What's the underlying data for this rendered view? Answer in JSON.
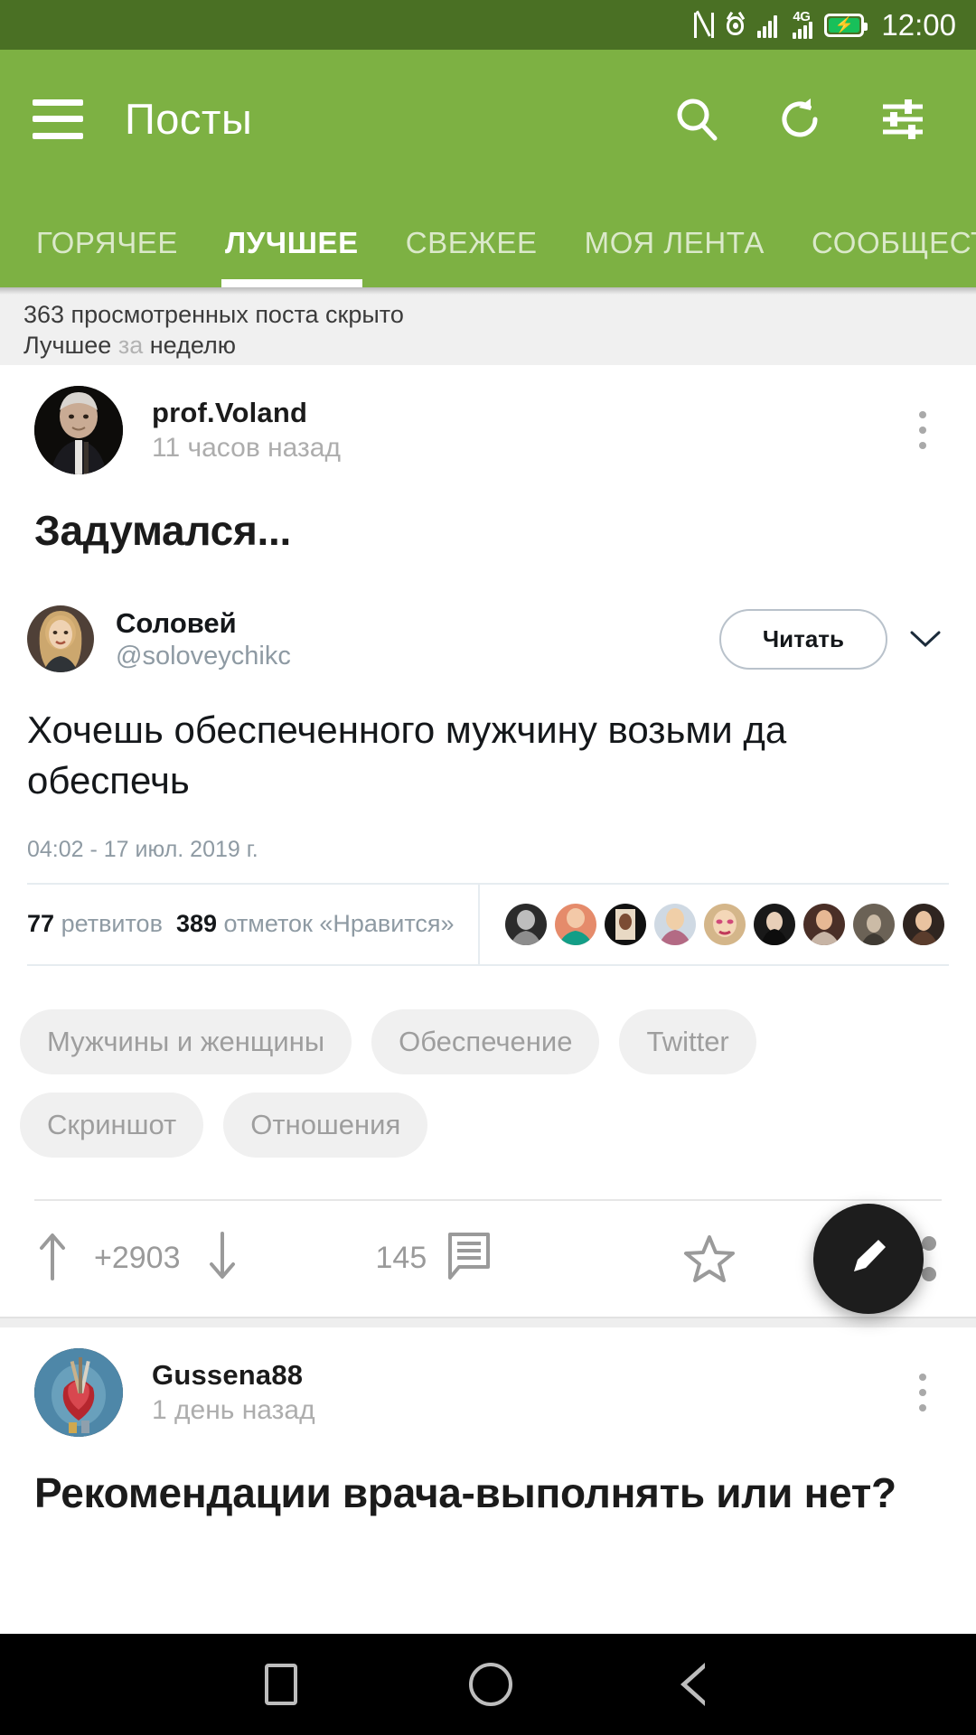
{
  "status_bar": {
    "time": "12:00",
    "icons": [
      "nfc-icon",
      "eye-icon",
      "signal-icon",
      "signal-4g-icon",
      "battery-charging-icon"
    ],
    "network_label": "4G"
  },
  "app_bar": {
    "title": "Посты",
    "menu_icon": "hamburger-icon",
    "actions": [
      "search-icon",
      "refresh-icon",
      "filter-icon"
    ]
  },
  "tabs": [
    {
      "label": "ГОРЯЧЕЕ",
      "active": false
    },
    {
      "label": "ЛУЧШЕЕ",
      "active": true
    },
    {
      "label": "СВЕЖЕЕ",
      "active": false
    },
    {
      "label": "МОЯ ЛЕНТА",
      "active": false
    },
    {
      "label": "СООБЩЕСТВА",
      "active": false
    }
  ],
  "info_strip": {
    "hidden_posts": "363 просмотренных поста скрыто",
    "sort_prefix": "Лучшее",
    "sort_dim": "за",
    "sort_suffix": "неделю"
  },
  "posts": [
    {
      "author": "prof.Voland",
      "time": "11 часов назад",
      "title": "Задумался...",
      "embed": {
        "name": "Соловей",
        "handle": "@soloveychikc",
        "read_button": "Читать",
        "text": "Хочешь  обеспеченного мужчину возьми да обеспечь",
        "date": "04:02 - 17 июл. 2019 г.",
        "retweets_count": "77",
        "retweets_label": "ретвитов",
        "likes_count": "389",
        "likes_label": "отметок «Нравится»",
        "likers_count": 9
      },
      "tags": [
        "Мужчины и женщины",
        "Обеспечение",
        "Twitter",
        "Скриншот",
        "Отношения"
      ],
      "rating": "+2903",
      "comments": "145"
    },
    {
      "author": "Gussena88",
      "time": "1 день назад",
      "title": "Рекомендации врача-выполнять или нет?"
    }
  ],
  "fab": {
    "icon": "pencil-icon"
  },
  "nav_bar": {
    "items": [
      "recents-button",
      "home-button",
      "back-button"
    ]
  },
  "colors": {
    "status_bar": "#4a7024",
    "app_bar": "#7db143",
    "accent": "#7db143",
    "battery": "#18c05a"
  }
}
